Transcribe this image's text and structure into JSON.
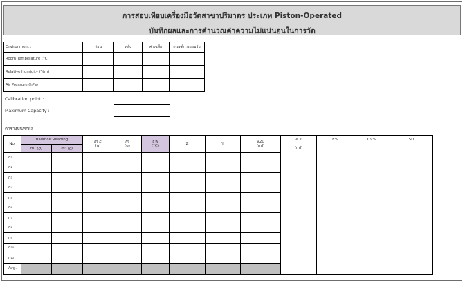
{
  "title": {
    "line1": "การสอบเทียบเครื่องมือวัดสาขาปริมาตร ประเภท Piston-Operated",
    "line2": "บันทึกผลและการคำนวณค่าความไม่แน่นอนในการวัด"
  },
  "environment": {
    "header": "Environment  :",
    "columns": [
      "ก่อน",
      "หลัง",
      "ค่าเฉลี่ย",
      "เกณฑ์การยอมรับ"
    ],
    "rows": [
      "Room Temperature  (°C)",
      "Relative Humidity (%rh)",
      "Air Pressure (hPa)"
    ]
  },
  "calibration": {
    "point_label": "Calibration point :",
    "capacity_label": "Maximum Capacity :"
  },
  "record_label": "ตารางบันทึกผล",
  "main_table": {
    "col_no": "No.",
    "balance_reading": "Balance Reading",
    "m1": "m₁ (g)",
    "m2": "m₂ (g)",
    "mE": "m E",
    "mE_unit": "(g)",
    "m": "m",
    "m_unit": "(g)",
    "tw": "t w",
    "tw_unit": "(°C)",
    "z": "Z",
    "y": "Y",
    "v20": "V20",
    "v20_unit": "(ml)",
    "es": "e s",
    "es_unit": "(ml)",
    "es_pct": "E%",
    "cv_pct": "CV%",
    "sd": "SD",
    "rows": [
      "n1",
      "n2",
      "n3",
      "n4",
      "n5",
      "n6",
      "n7",
      "n8",
      "n9",
      "n10",
      "n11"
    ],
    "row_display": [
      "n₁",
      "n₂",
      "n₃",
      "n₄",
      "n₅",
      "n₆",
      "n₇",
      "n₈",
      "n₉",
      "n₁₀",
      "n₁₁"
    ],
    "avg": "Avg."
  }
}
